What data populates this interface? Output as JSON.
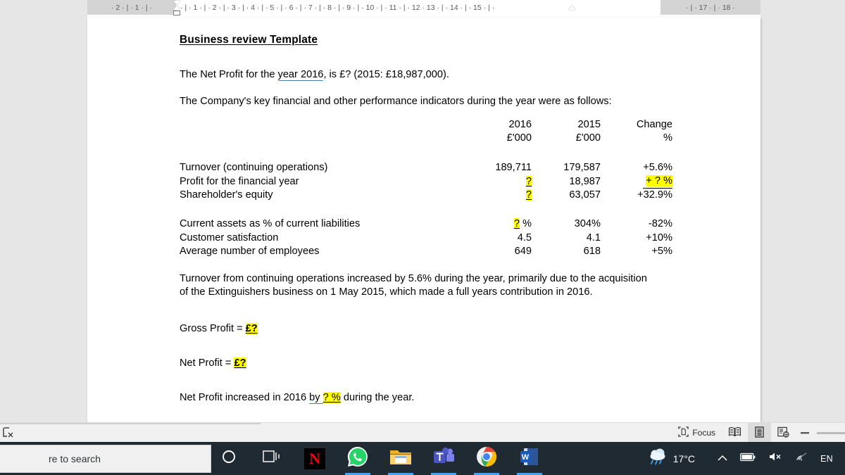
{
  "ruler": {
    "left_margin_ticks": "·  2  ·  |  ·  1  ·  |  ·",
    "body_ticks": "·  |  ·  1  ·  |  ·  2  ·  |  ·  3  ·  |  ·  4  ·  |  ·  5  ·  |  ·  6  ·  |  ·  7  ·  |  ·  8  ·  |  ·  9  ·  |  · 10 ·  |  · 11 ·  |  · 12 ·     13 ·  |  · 14 ·  |  · 15 ·  |  ·",
    "right_margin_ticks": "·  |  · 17 ·  |  · 18 ·"
  },
  "document": {
    "title": "Business review Template",
    "intro_before": "The Net Profit for the ",
    "intro_spell": "year 2016",
    "intro_after": ", is £? (2015: £18,987,000).",
    "indicators_line": "The Company's key financial and other performance indicators during the year were as follows:",
    "table": {
      "headers": {
        "col1_year": "2016",
        "col2_year": "2015",
        "col3_label": "Change",
        "col1_unit": "£'000",
        "col2_unit": "£'000",
        "col3_unit": "%"
      },
      "rows_group1": [
        {
          "label": "Turnover (continuing operations)",
          "c1": "189,711",
          "c1_highlight": false,
          "c2": "179,587",
          "c3": "+5.6%",
          "c3_highlight": false
        },
        {
          "label": "Profit for the financial year",
          "c1": "?",
          "c1_highlight": true,
          "c2": "18,987",
          "c3": "+ ? %",
          "c3_highlight": true
        },
        {
          "label": "Shareholder's equity",
          "c1": "?",
          "c1_highlight": true,
          "c2": "63,057",
          "c3": "+32.9%",
          "c3_highlight": false
        }
      ],
      "rows_group2": [
        {
          "label": "Current assets as % of current liabilities",
          "c1": "?",
          "c1_suffix": " %",
          "c1_highlight": true,
          "c2": "304%",
          "c3": "-82%",
          "c3_highlight": false
        },
        {
          "label": "Customer satisfaction",
          "c1": "4.5",
          "c1_suffix": "",
          "c1_highlight": false,
          "c2": "4.1",
          "c3": "+10%",
          "c3_highlight": false
        },
        {
          "label": "Average number of employees",
          "c1": "649",
          "c1_suffix": "",
          "c1_highlight": false,
          "c2": "618",
          "c3": "+5%",
          "c3_highlight": false
        }
      ]
    },
    "paragraph": "Turnover from continuing operations increased by 5.6% during the year, primarily due to the acquisition of the Extinguishers business on 1 May 2015, which made a full years contribution in 2016.",
    "gross_profit_label": "Gross Profit = ",
    "gross_profit_value": "£?",
    "net_profit_label": "Net Profit = ",
    "net_profit_value": "£?",
    "closing_before": "Net Profit increased in 2016 ",
    "closing_spell": "by ",
    "closing_highlight": "? %",
    "closing_after": " during the year."
  },
  "statusbar": {
    "focus_label": "Focus",
    "read_mode_icon": "read-mode-icon",
    "print_layout_icon": "print-layout-icon",
    "web_layout_icon": "web-layout-icon",
    "zoom_out_label": "−"
  },
  "taskbar": {
    "search_placeholder": "re to search",
    "items": [
      {
        "name": "cortana",
        "label": "Cortana",
        "active": false
      },
      {
        "name": "task-view",
        "label": "Task View",
        "active": false
      },
      {
        "name": "netflix",
        "label": "Netflix",
        "active": false
      },
      {
        "name": "whatsapp",
        "label": "WhatsApp",
        "active": true
      },
      {
        "name": "file-explorer",
        "label": "File Explorer",
        "active": true
      },
      {
        "name": "microsoft-teams",
        "label": "Microsoft Teams",
        "active": true
      },
      {
        "name": "google-chrome",
        "label": "Google Chrome",
        "active": true
      },
      {
        "name": "microsoft-word",
        "label": "Microsoft Word",
        "active": true
      }
    ],
    "tray": {
      "weather_temp": "17°C",
      "weather_icon": "rain-cloud-icon",
      "show_hidden_icon": "chevron-up-icon",
      "battery_icon": "battery-icon",
      "volume_icon": "volume-muted-icon",
      "network_icon": "wifi-icon",
      "language": "EN"
    }
  },
  "colors": {
    "highlight": "#FFFF00",
    "spellcheck_underline": "#4a7ebb",
    "taskbar_bg": "#1f2a33",
    "taskbar_active": "#4aa3e8",
    "page_bg": "#ffffff",
    "canvas_bg": "#e6e6e6"
  }
}
